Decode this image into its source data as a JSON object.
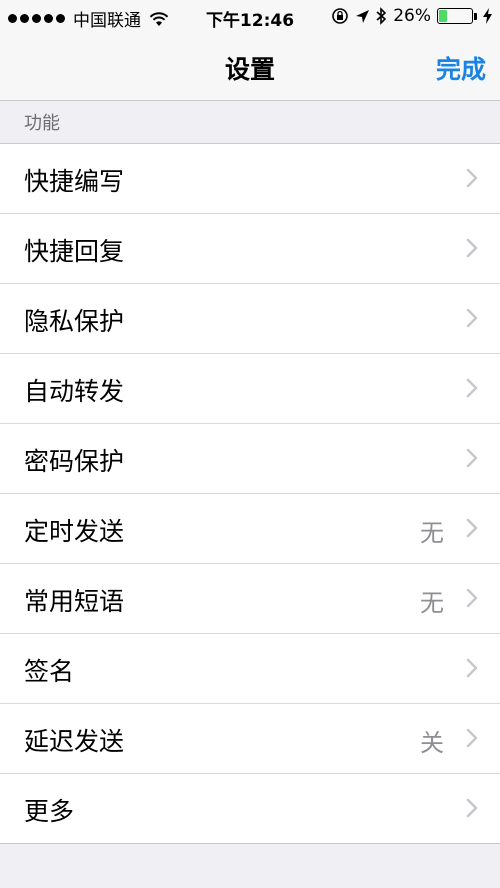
{
  "statusbar": {
    "carrier": "中国联通",
    "time": "下午12:46",
    "battery_percent": "26%",
    "battery_level": 0.26,
    "signal_icon": "signal-dots-icon",
    "wifi_icon": "wifi-icon",
    "lock_icon": "rotation-lock-icon",
    "location_icon": "location-arrow-icon",
    "bluetooth_icon": "bluetooth-icon",
    "charging_icon": "charging-bolt-icon"
  },
  "navbar": {
    "title": "设置",
    "done_label": "完成"
  },
  "section": {
    "header": "功能"
  },
  "items": [
    {
      "label": "快捷编写",
      "value": ""
    },
    {
      "label": "快捷回复",
      "value": ""
    },
    {
      "label": "隐私保护",
      "value": ""
    },
    {
      "label": "自动转发",
      "value": ""
    },
    {
      "label": "密码保护",
      "value": ""
    },
    {
      "label": "定时发送",
      "value": "无"
    },
    {
      "label": "常用短语",
      "value": "无"
    },
    {
      "label": "签名",
      "value": ""
    },
    {
      "label": "延迟发送",
      "value": "关"
    },
    {
      "label": "更多",
      "value": ""
    }
  ],
  "colors": {
    "accent": "#1b84e3",
    "battery_green": "#4cd964",
    "background": "#efeff4"
  }
}
